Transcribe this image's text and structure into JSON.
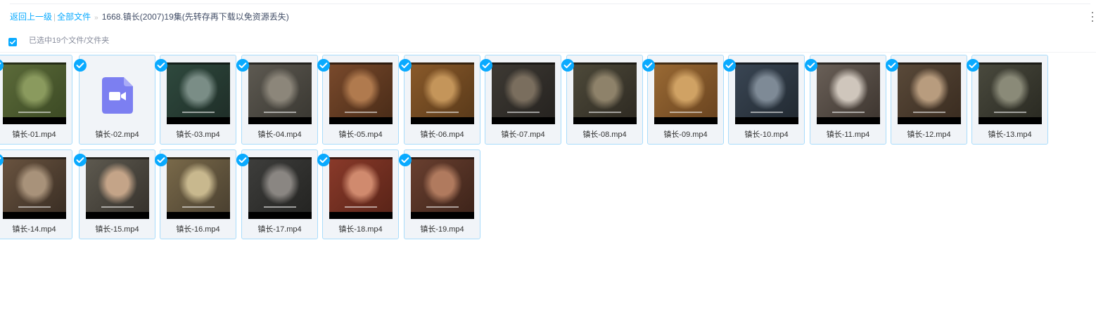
{
  "breadcrumb": {
    "back": "返回上一级",
    "separator": "|",
    "root": "全部文件",
    "arrow": "»",
    "current": "1668.镇长(2007)19集(先转存再下载以免资源丢失)"
  },
  "more_icon": "vertical-ellipsis-icon",
  "selection": {
    "text": "已选中19个文件/文件夹",
    "all_selected": true
  },
  "accent_color": "#09aaff",
  "files": [
    {
      "name": "镇长-01.mp4",
      "thumb": "green",
      "selected": true
    },
    {
      "name": "镇长-02.mp4",
      "thumb": "video-icon",
      "selected": true
    },
    {
      "name": "镇长-03.mp4",
      "thumb": "teal",
      "selected": true
    },
    {
      "name": "镇长-04.mp4",
      "thumb": "gray",
      "selected": true
    },
    {
      "name": "镇长-05.mp4",
      "thumb": "brown",
      "selected": true
    },
    {
      "name": "镇长-06.mp4",
      "thumb": "amber",
      "selected": true
    },
    {
      "name": "镇长-07.mp4",
      "thumb": "dark",
      "selected": true
    },
    {
      "name": "镇长-08.mp4",
      "thumb": "olive",
      "selected": true
    },
    {
      "name": "镇长-09.mp4",
      "thumb": "orange",
      "selected": true
    },
    {
      "name": "镇长-10.mp4",
      "thumb": "slate",
      "selected": true
    },
    {
      "name": "镇长-11.mp4",
      "thumb": "light",
      "selected": true
    },
    {
      "name": "镇长-12.mp4",
      "thumb": "warm",
      "selected": true
    },
    {
      "name": "镇长-13.mp4",
      "thumb": "grayolive",
      "selected": true
    },
    {
      "name": "镇长-14.mp4",
      "thumb": "tan",
      "selected": true
    },
    {
      "name": "镇长-15.mp4",
      "thumb": "skin",
      "selected": true
    },
    {
      "name": "镇长-16.mp4",
      "thumb": "sunny",
      "selected": true
    },
    {
      "name": "镇长-17.mp4",
      "thumb": "graydark",
      "selected": true
    },
    {
      "name": "镇长-18.mp4",
      "thumb": "red",
      "selected": true
    },
    {
      "name": "镇长-19.mp4",
      "thumb": "rust",
      "selected": true
    }
  ]
}
